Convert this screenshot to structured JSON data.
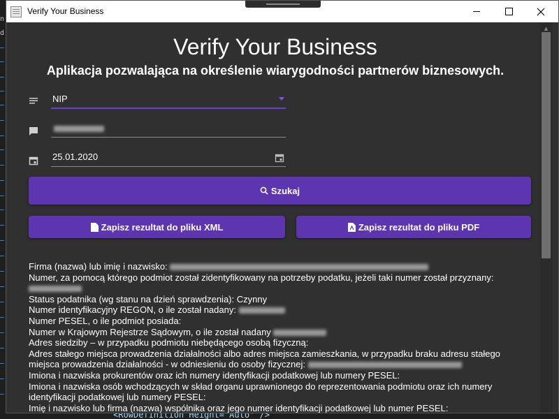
{
  "window": {
    "title": "Verify Your Business"
  },
  "background_editor": {
    "left_chars": [
      "n",
      "d"
    ],
    "bottom_code": "<RowDefinition Height=\"Auto\" />"
  },
  "header": {
    "title": "Verify Your Business",
    "subtitle": "Aplikacja pozwalająca na określenie wiarygodności partnerów biznesowych."
  },
  "form": {
    "id_type": {
      "value": "NIP",
      "icon": "list-icon"
    },
    "number": {
      "value": "",
      "icon": "comment-icon"
    },
    "date": {
      "value": "25.01.2020",
      "icon": "calendar-icon"
    }
  },
  "buttons": {
    "search": "Szukaj",
    "save_xml": "Zapisz rezultat do pliku XML",
    "save_pdf": "Zapisz rezultat do pliku PDF"
  },
  "results": {
    "company_name": "Firma (nazwa) lub imię i nazwisko:",
    "tax_number": "Numer, za pomocą którego podmiot został zidentyfikowany na potrzeby podatku, jeżeli taki numer został przyznany:",
    "status_label": "Status podatnika (wg stanu na dzień sprawdzenia):",
    "status_value": "Czynny",
    "regon": "Numer identyfikacyjny REGON, o ile został nadany:",
    "pesel": "Numer PESEL, o ile podmiot posiada:",
    "krs": "Numer w Krajowym Rejestrze Sądowym, o ile został nadany",
    "residence": "Adres siedziby – w przypadku podmiotu niebędącego osobą fizyczną:",
    "business_address_1": "Adres stałego miejsca prowadzenia działalności albo adres miejsca zamieszkania, w przypadku braku adresu stałego",
    "business_address_2": "miejsca prowadzenia działalności - w odniesieniu do osoby fizycznej:",
    "proxies": "Imiona i nazwiska prokurentów oraz ich numery identyfikacji podatkowej lub numery PESEL:",
    "board_1": "Imiona i nazwiska osób wchodzących w skład organu uprawnionego do reprezentowania podmiotu oraz ich numery",
    "board_2": "identyfikacji podatkowej lub numery PESEL:",
    "partners": "Imię i nazwisko lub firma (nazwa) wspólnika oraz jego numer identyfikacji podatkowej lub numer PESEL:"
  },
  "colors": {
    "accent": "#5e35b1",
    "background": "#303030",
    "text": "#ffffff"
  }
}
